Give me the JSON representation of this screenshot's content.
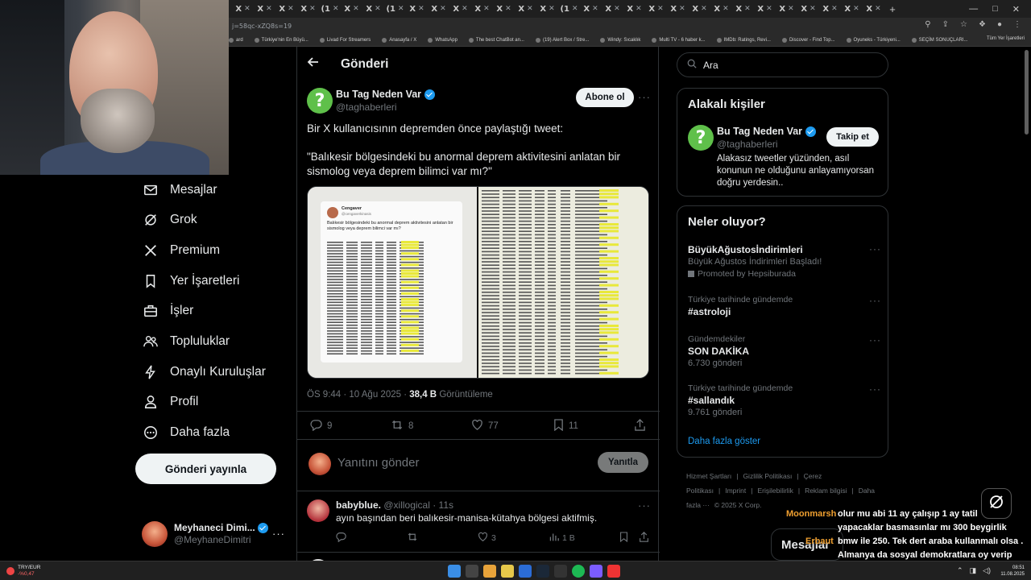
{
  "browser": {
    "tabs": [
      "X",
      "X",
      "X",
      "X",
      "(1",
      "X",
      "X",
      "(1",
      "X",
      "X",
      "X",
      "X",
      "X",
      "X",
      "X",
      "(1",
      "X",
      "X",
      "X",
      "X",
      "X",
      "X",
      "X",
      "X",
      "X",
      "X",
      "X",
      "X",
      "X",
      "X"
    ],
    "url": "j=58qc-xZQ8s=19",
    "bookmarks": [
      "ard",
      "Türkiye'nin En Büyü...",
      "Livad For Streamers",
      "Anasayfa / X",
      "WhatsApp",
      "The best ChatBot an...",
      "(19) Alert Box / Stre...",
      "Windy: Sıcaklık",
      "Multi TV - 6 haber k...",
      "IMDb: Ratings, Revi...",
      "Discover - Find Top...",
      "Oyuneks - Türkiyeni...",
      "SEÇİM SONUÇLARI..."
    ],
    "all_bookmarks": "Tüm Yer İşaretleri"
  },
  "sidebar": {
    "items": [
      {
        "label": "Mesajlar",
        "icon": "mail-icon"
      },
      {
        "label": "Grok",
        "icon": "grok-icon"
      },
      {
        "label": "Premium",
        "icon": "x-logo-icon"
      },
      {
        "label": "Yer İşaretleri",
        "icon": "bookmark-icon"
      },
      {
        "label": "İşler",
        "icon": "briefcase-icon"
      },
      {
        "label": "Topluluklar",
        "icon": "people-icon"
      },
      {
        "label": "Onaylı Kuruluşlar",
        "icon": "lightning-icon"
      },
      {
        "label": "Profil",
        "icon": "person-icon"
      },
      {
        "label": "Daha fazla",
        "icon": "more-circle-icon"
      }
    ],
    "post_button": "Gönderi yayınla",
    "account": {
      "name": "Meyhaneci Dimi...",
      "handle": "@MeyhaneDimitri"
    }
  },
  "main": {
    "header_title": "Gönderi",
    "tweet": {
      "author_name": "Bu Tag Neden Var",
      "author_handle": "@taghaberleri",
      "subscribe": "Abone ol",
      "text1": "Bir X kullanıcısının depremden önce paylaştığı tweet:",
      "text2": "\"Balıkesir bölgesindeki bu anormal deprem aktivitesini anlatan bir sismolog veya deprem bilimci var mı?\"",
      "image_card": {
        "name": "Cengaver",
        "handle": "@cengaverkinasis",
        "text": "Balıkesir bölgesindeki bu anormal deprem aktivitesini anlatan bir sismolog veya deprem bilimci var mı?"
      },
      "time": "ÖS 9:44 · 10 Ağu 2025 · ",
      "views": "38,4 B",
      "views_label": " Görüntüleme",
      "replies": "9",
      "retweets": "8",
      "likes": "77",
      "bookmarks": "11"
    },
    "reply_placeholder": "Yanıtını gönder",
    "reply_button": "Yanıtla",
    "comment": {
      "name": "babyblue.",
      "handle": "@xillogical · 11s",
      "text": "ayın başından beri balıkesir-manisa-kütahya bölgesi aktifmiş.",
      "replies": "",
      "retweets": "",
      "likes": "3",
      "views": "1 B"
    }
  },
  "right": {
    "search_placeholder": "Ara",
    "related_title": "Alakalı kişiler",
    "related": {
      "name": "Bu Tag Neden Var",
      "handle": "@taghaberleri",
      "follow": "Takip et",
      "bio": "Alakasız tweetler yüzünden, asıl konunun ne olduğunu anlayamıyorsan doğru yerdesin.."
    },
    "trends_title": "Neler oluyor?",
    "trends": [
      {
        "context": "",
        "title": "BüyükAğustosİndirimleri",
        "sub": "Büyük Ağustos İndirimleri Başladı!",
        "extra": "Promoted by Hepsiburada"
      },
      {
        "context": "Türkiye tarihinde gündemde",
        "title": "#astroloji",
        "sub": "",
        "extra": ""
      },
      {
        "context": "Gündemdekiler",
        "title": "SON DAKİKA",
        "sub": "6.730 gönderi",
        "extra": ""
      },
      {
        "context": "Türkiye tarihinde gündemde",
        "title": "#sallandık",
        "sub": "9.761 gönderi",
        "extra": ""
      }
    ],
    "show_more": "Daha fazla göster",
    "footer": [
      "Hizmet Şartları",
      "|",
      "Gizlilik Politikası",
      "|",
      "Çerez Politikası",
      "|",
      "Imprint",
      "|",
      "Erişilebilirlik",
      "|",
      "Reklam bilgisi",
      "|",
      "Daha fazla ···",
      "© 2025 X Corp."
    ]
  },
  "overlay": {
    "messages_bubble": "Mesajlar",
    "chat_user1": "Moonmarsh",
    "chat_user2": "Erbaut",
    "chat_text": "olur mu abi 11 ay çalışıp 1 ay tatil yapacaklar basmasınlar mı 300 beygirlik bmw ile 250. Tek dert araba kullanmalı olsa . Almanya da sosyal demokratlara oy verip burada malum partiye oy veriyorlar."
  },
  "taskbar": {
    "ticker_name": "TRY/EUR",
    "ticker_value": "-%0,47",
    "time": "08:51",
    "date": "11.08.2025"
  },
  "colors": {
    "accent": "#1d9bf0",
    "background": "#000000",
    "verified": "#1d9bf0"
  }
}
